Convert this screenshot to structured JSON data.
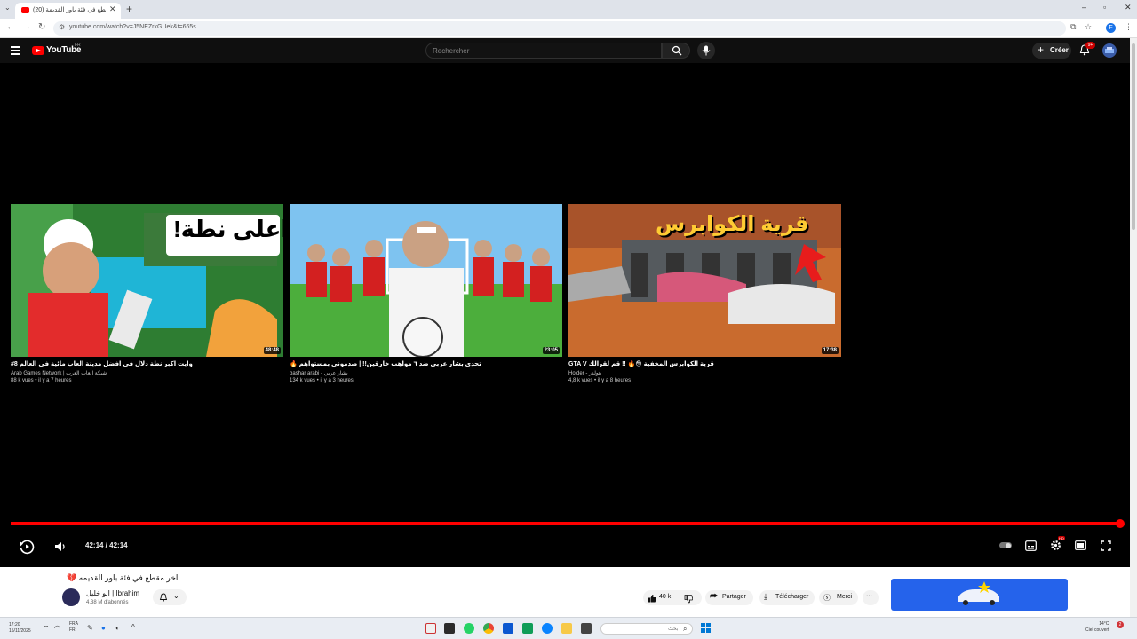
{
  "browser": {
    "tab_title": "(20) اخر مقطع في فئة باور القديمة",
    "url": "youtube.com/watch?v=J5NEZrkGUek&t=665s",
    "new_tab": "+",
    "profile_initial": "F"
  },
  "header": {
    "logo_text": "YouTube",
    "country": "FR",
    "search_placeholder": "Rechercher",
    "create_label": "Créer",
    "notif_badge": "9+"
  },
  "end_cards": [
    {
      "title": "#8 وايت اكبر نطة دلال في افضل مدينة العاب مائية في العالم",
      "channel": "Arab Games Network | شبكة العاب العرب",
      "meta": "88 k vues • il y a 7 heures",
      "duration": "48:48"
    },
    {
      "title": "🔥 تحدي بشار عربي ضد ٦ مواهب خارقين!! | صدموني بمستواهم",
      "channel": "bashar arabi - بشار عربي",
      "meta": "134 k vues • il y a 3 heures",
      "duration": "23:05"
    },
    {
      "title": "GTA V قرية الكوابرس المخفية 😳🔥 !! قم لقرالك",
      "channel": "Holder - هولدر",
      "meta": "4,8 k vues • il y a 8 heures",
      "duration": "17:38"
    }
  ],
  "thumb_texts": [
    "اعلى نطة!",
    "",
    "قرية الكوابرس"
  ],
  "player": {
    "time": "42:14 / 42:14",
    "progress": 1.0,
    "hd_badge": "HD"
  },
  "video": {
    "title": "اخر مقطع في فئة باور القديمه 💔 .",
    "channel_name": "ابو خليل | Ibrahim",
    "subscribers": "4,38 M d'abonnés",
    "likes": "40 k",
    "share_label": "Partager",
    "download_label": "Télécharger",
    "thanks_label": "Merci",
    "more_label": "···"
  },
  "taskbar": {
    "time": "17:20",
    "date": "15/11/2025",
    "lang": "FRA",
    "lang2": "FR",
    "search_text": "بحث",
    "weather_temp": "14°C",
    "weather_text": "Ciel couvert",
    "notif_count": "2"
  },
  "colors": {
    "yt_red": "#ff0000",
    "player_bg": "#000000",
    "header_bg": "#0f0f0f"
  }
}
